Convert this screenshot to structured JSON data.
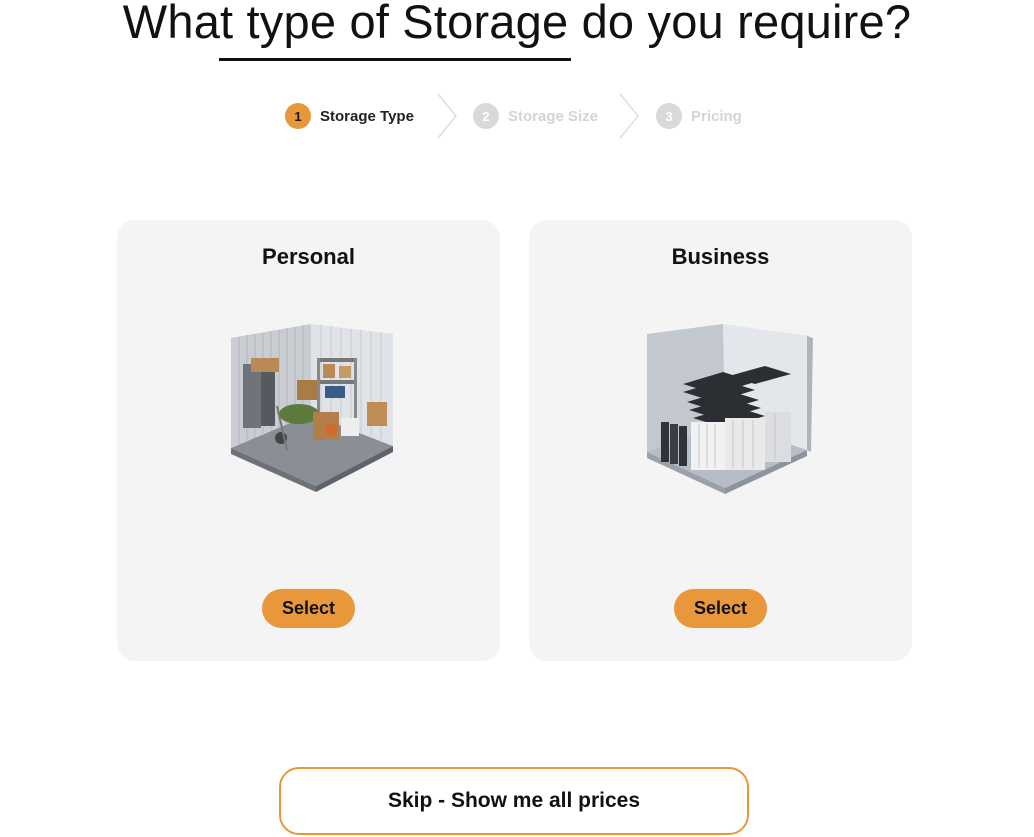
{
  "heading": {
    "text": "What type of Storage do you require?"
  },
  "stepper": {
    "steps": [
      {
        "number": "1",
        "label": "Storage Type",
        "state": "active"
      },
      {
        "number": "2",
        "label": "Storage Size",
        "state": "inactive"
      },
      {
        "number": "3",
        "label": "Pricing",
        "state": "inactive"
      }
    ]
  },
  "cards": [
    {
      "title": "Personal",
      "button_label": "Select",
      "illustration": "storage-unit-household-items-icon"
    },
    {
      "title": "Business",
      "button_label": "Select",
      "illustration": "storage-unit-office-files-icon"
    }
  ],
  "skip": {
    "label": "Skip - Show me all prices"
  },
  "colors": {
    "accent": "#e8973a",
    "card_bg": "#f4f4f4",
    "inactive_step": "#d9d9d9",
    "text": "#111111"
  }
}
